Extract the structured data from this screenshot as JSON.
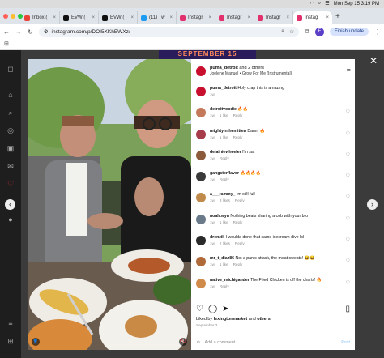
{
  "menubar": {
    "datetime": "Mon Sep 15  3:19 PM"
  },
  "tabs": [
    {
      "label": "Inbox (",
      "color": "#ea4335",
      "active": false
    },
    {
      "label": "EVW (",
      "color": "#111111",
      "active": false
    },
    {
      "label": "EVW (",
      "color": "#111111",
      "active": false
    },
    {
      "label": "(11) Tw",
      "color": "#1d9bf0",
      "active": false
    },
    {
      "label": "Instagr",
      "color": "#e1306c",
      "active": false
    },
    {
      "label": "Instagr",
      "color": "#e1306c",
      "active": false
    },
    {
      "label": "Instagr",
      "color": "#e1306c",
      "active": false
    },
    {
      "label": "Instag",
      "color": "#e1306c",
      "active": true
    }
  ],
  "toolbar": {
    "url": "instagram.com/p/DOI5XKhEWXz/",
    "profile_initial": "E",
    "finish_update": "Finish update"
  },
  "page_banner": "SEPTEMBER 15",
  "post": {
    "author": "puma_detroit",
    "and_others": "and 2 others",
    "subtitle": "Joelene Manuel • Grow For Me (Instrumental)",
    "caption_user": "puma_detroit",
    "caption_text": "Holy crap this is amazing",
    "caption_age": "1w",
    "liked_by_user": "lexingtonmarket",
    "liked_by_suffix": "others",
    "date": "September 3",
    "add_comment_placeholder": "Add a comment...",
    "post_label": "Post"
  },
  "comments": [
    {
      "user": "detroitvoodie",
      "text": "🔥🔥",
      "age": "1w",
      "likes": "1 like",
      "color": "#c47a5a"
    },
    {
      "user": "mightyinthemitten",
      "text": "Damn 🔥",
      "age": "1w",
      "likes": "1 like",
      "color": "#a63b4a"
    },
    {
      "user": "delainiewheeler",
      "text": "I'm sat",
      "age": "1w",
      "likes": "",
      "color": "#8a5a3a"
    },
    {
      "user": "gangsterflavor",
      "text": "🔥🔥🔥🔥",
      "age": "1w",
      "likes": "",
      "color": "#3a3a3a"
    },
    {
      "user": "a___rammy_",
      "text": "Im still full",
      "age": "1w",
      "likes": "3 likes",
      "color": "#c08a4a"
    },
    {
      "user": "noah.wyn",
      "text": "Nothing beats sharing a cob with your bro",
      "age": "1w",
      "likes": "1 like",
      "color": "#6a7a8a"
    },
    {
      "user": "drenzik",
      "text": "I woulda done that same icecream dive lol",
      "age": "1w",
      "likes": "2 likes",
      "color": "#2a2a2a"
    },
    {
      "user": "mr_t_diaz86",
      "text": "Not a panic attack, the meat sweats! 😂😂",
      "age": "1w",
      "likes": "1 like",
      "color": "#b06a3a"
    },
    {
      "user": "native_michigander",
      "text": "The Fried Chicken is off the charts! 🔥",
      "age": "1w",
      "likes": "",
      "color": "#d08a4a"
    }
  ],
  "reply_label": "Reply",
  "bookmarks_icon": "apps-grid-icon"
}
